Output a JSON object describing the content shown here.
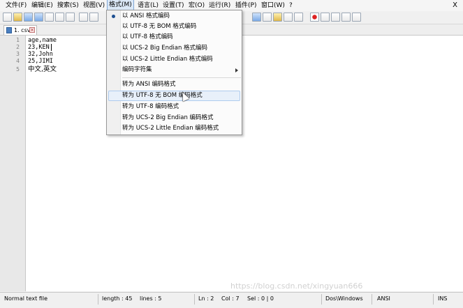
{
  "menubar": {
    "items": [
      "文件(F)",
      "编辑(E)",
      "搜索(S)",
      "视图(V)",
      "格式(M)",
      "语言(L)",
      "设置(T)",
      "宏(O)",
      "运行(R)",
      "插件(P)",
      "窗口(W)",
      "?"
    ],
    "close_glyph": "X"
  },
  "tab": {
    "label": "1. csv",
    "close_glyph": "×"
  },
  "editor": {
    "line_numbers": [
      "1",
      "2",
      "3",
      "4",
      "5"
    ],
    "lines": [
      "age,name",
      "23,KEN",
      "32,John",
      "25,JIMI",
      "中文,英文"
    ]
  },
  "format_menu": {
    "items": [
      "以 ANSI 格式编码",
      "以 UTF-8 无 BOM 格式编码",
      "以 UTF-8 格式编码",
      "以 UCS-2 Big Endian 格式编码",
      "以 UCS-2 Little Endian 格式编码",
      "编码字符集",
      "转为 ANSI 编码格式",
      "转为 UTF-8 无 BOM 编码格式",
      "转为 UTF-8 编码格式",
      "转为 UCS-2 Big Endian 编码格式",
      "转为 UCS-2 Little Endian 编码格式"
    ]
  },
  "status": {
    "file_type": "Normal text file",
    "length": "length : 45",
    "lines": "lines : 5",
    "ln": "Ln : 2",
    "col": "Col : 7",
    "sel": "Sel : 0 | 0",
    "eol": "Dos\\Windows",
    "encoding": "ANSI",
    "mode": "INS"
  },
  "watermark": "https://blog.csdn.net/xingyuan666"
}
